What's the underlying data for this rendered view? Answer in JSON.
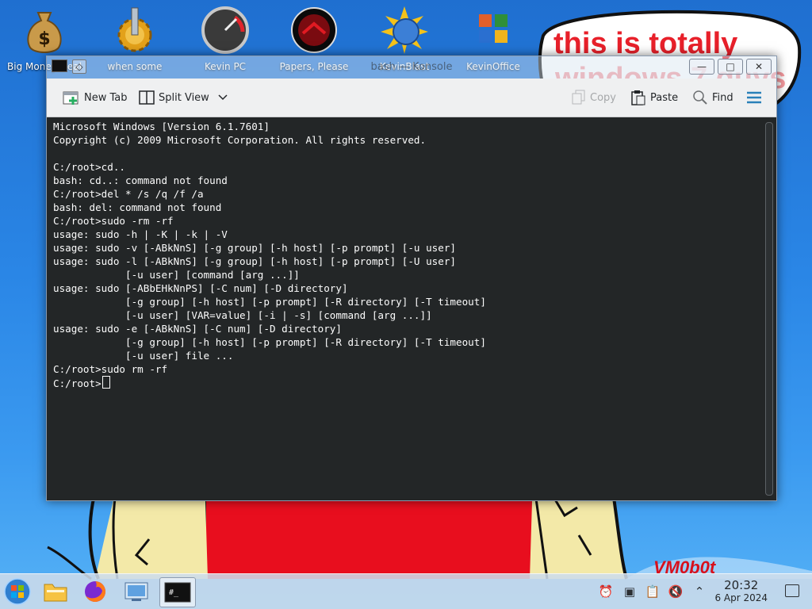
{
  "desktop": {
    "icons": [
      {
        "label": "Big Money Deal",
        "icon": "money-bag-icon"
      },
      {
        "label": "when some",
        "icon": "gear-icon"
      },
      {
        "label": "Kevin PC",
        "icon": "speedometer-icon"
      },
      {
        "label": "Papers, Please",
        "icon": "red-seal-icon"
      },
      {
        "label": "KevinBlast",
        "icon": "globe-disc-icon"
      },
      {
        "label": "KevinOffice",
        "icon": "office-logo-icon"
      }
    ],
    "graffiti_top": "this is totally",
    "graffiti_bottom": "windows 7 guys",
    "watermark": "VM0b0t"
  },
  "terminal": {
    "title": "bash — Konsole",
    "toolbar": {
      "new_tab": "New Tab",
      "split_view": "Split View",
      "copy": "Copy",
      "paste": "Paste",
      "find": "Find"
    },
    "lines": [
      "Microsoft Windows [Version 6.1.7601]",
      "Copyright (c) 2009 Microsoft Corporation. All rights reserved.",
      "",
      "C:/root>cd..",
      "bash: cd..: command not found",
      "C:/root>del * /s /q /f /a",
      "bash: del: command not found",
      "C:/root>sudo -rm -rf",
      "usage: sudo -h | -K | -k | -V",
      "usage: sudo -v [-ABkNnS] [-g group] [-h host] [-p prompt] [-u user]",
      "usage: sudo -l [-ABkNnS] [-g group] [-h host] [-p prompt] [-U user]",
      "            [-u user] [command [arg ...]]",
      "usage: sudo [-ABbEHkNnPS] [-C num] [-D directory]",
      "            [-g group] [-h host] [-p prompt] [-R directory] [-T timeout]",
      "            [-u user] [VAR=value] [-i | -s] [command [arg ...]]",
      "usage: sudo -e [-ABkNnS] [-C num] [-D directory]",
      "            [-g group] [-h host] [-p prompt] [-R directory] [-T timeout]",
      "            [-u user] file ...",
      "C:/root>sudo rm -rf"
    ],
    "prompt": "C:/root>"
  },
  "taskbar": {
    "items": [
      "start-orb-icon",
      "file-manager-icon",
      "firefox-icon",
      "control-panel-icon",
      "terminal-icon"
    ],
    "terminal_badge": "#_",
    "clock_time": "20:32",
    "clock_date": "6 Apr 2024"
  },
  "colors": {
    "console_bg": "#232627",
    "console_fg": "#fcfcfc",
    "graffiti_red": "#e8202a",
    "toolbar_accent": "#2980b9"
  }
}
